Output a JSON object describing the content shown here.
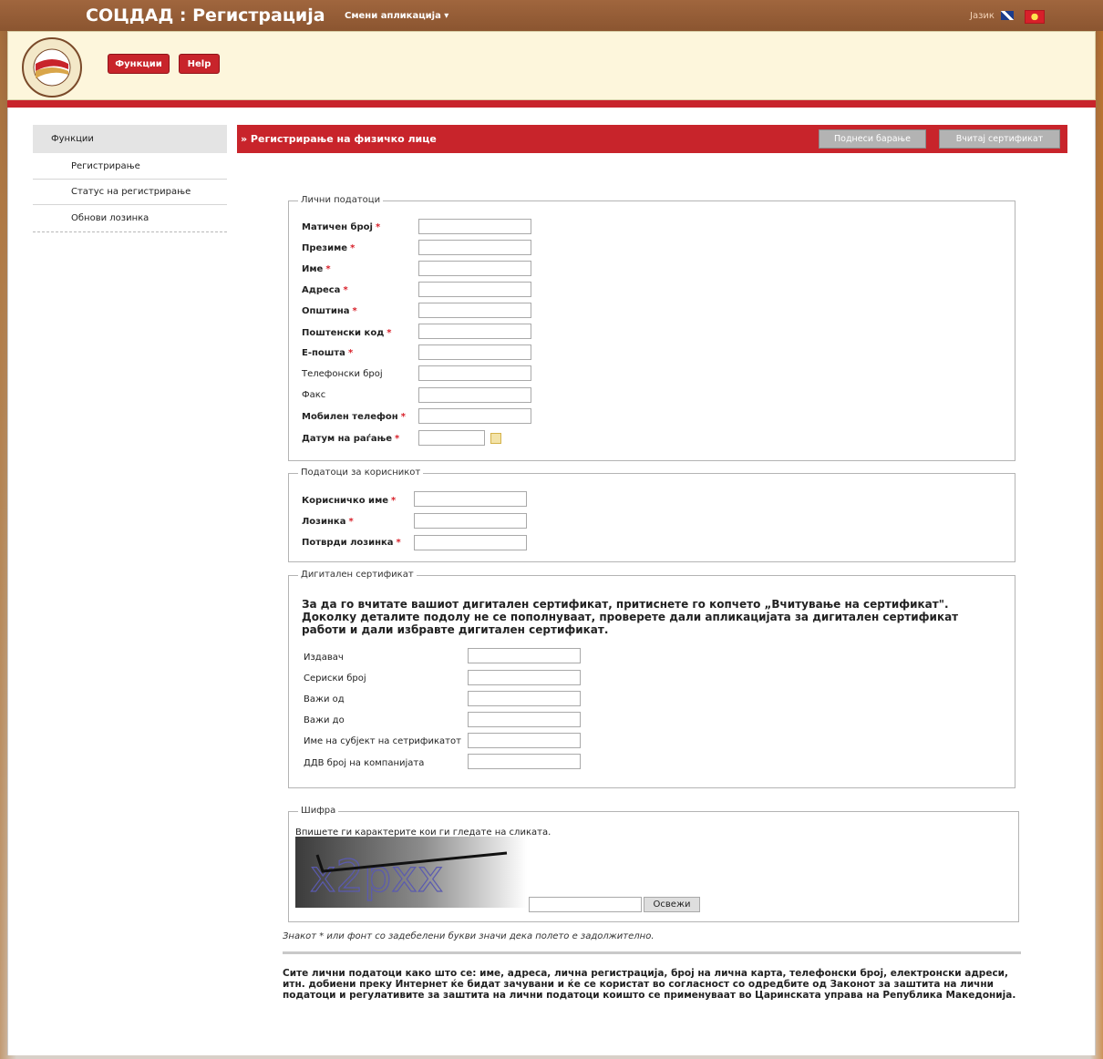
{
  "topbar": {
    "title": "СОЦДАД : Регистрација",
    "app_switch": "Смени апликација ▾",
    "language_label": "Јазик"
  },
  "header": {
    "functions_button": "Функции",
    "help_button": "Help"
  },
  "sidebar": {
    "heading": "Функции",
    "items": [
      {
        "label": "Регистрирање"
      },
      {
        "label": "Статус на регистрирање"
      },
      {
        "label": "Обнови лозинка"
      }
    ]
  },
  "page": {
    "title": "» Регистрирање на физичко лице",
    "submit_button": "Поднеси барање",
    "load_cert_button": "Вчитај сертификат"
  },
  "personal": {
    "legend": "Лични податоци",
    "fields": [
      {
        "label": "Матичен број",
        "required": true
      },
      {
        "label": "Презиме",
        "required": true
      },
      {
        "label": "Име",
        "required": true
      },
      {
        "label": "Адреса",
        "required": true
      },
      {
        "label": "Општина",
        "required": true
      },
      {
        "label": "Поштенски код",
        "required": true
      },
      {
        "label": "Е-пошта",
        "required": true
      },
      {
        "label": "Телефонски број",
        "required": false
      },
      {
        "label": "Факс",
        "required": false
      },
      {
        "label": "Мобилен телефон",
        "required": true
      },
      {
        "label": "Датум на раѓање",
        "required": true
      }
    ],
    "required_mark": "*"
  },
  "user": {
    "legend": "Податоци за корисникот",
    "fields": [
      {
        "label": "Корисничко име",
        "required": true
      },
      {
        "label": "Лозинка",
        "required": true
      },
      {
        "label": "Потврди лозинка",
        "required": true
      }
    ]
  },
  "certificate": {
    "legend": "Дигитален сертификат",
    "instructions": [
      "За да го вчитате вашиот дигитален сертификат, притиснете го копчето „Вчитување на сертификат\".",
      "Доколку деталите подолу не се пополнуваат, проверете дали апликацијата за дигитален сертификат",
      "работи и дали избравте дигитален сертификат."
    ],
    "fields": [
      {
        "label": "Издавач"
      },
      {
        "label": "Сериски број"
      },
      {
        "label": "Важи од"
      },
      {
        "label": "Важи до"
      },
      {
        "label": "Име на субјект на сетрификатот"
      },
      {
        "label": "ДДВ број на компанијата"
      }
    ]
  },
  "captcha": {
    "legend": "Шифра",
    "instruction": "Впишете ги карактерите кои ги гледате на сликата.",
    "image_text": "x2pxx",
    "refresh_button": "Освежи"
  },
  "note": "Знакот * или фонт со задебелени букви значи дека полето е задолжително.",
  "privacy": "Сите лични податоци како што се: име, адреса, лична регистрација, број на лична карта, телефонски број, електронски адреси, итн. добиени преку Интернет ќе бидат зачувани и ќе се користат во согласност со одредбите од Законот за заштита на лични податоци и регулативите за заштита на лични податоци коишто се применуваат во Царинската управа на Република Македонија."
}
